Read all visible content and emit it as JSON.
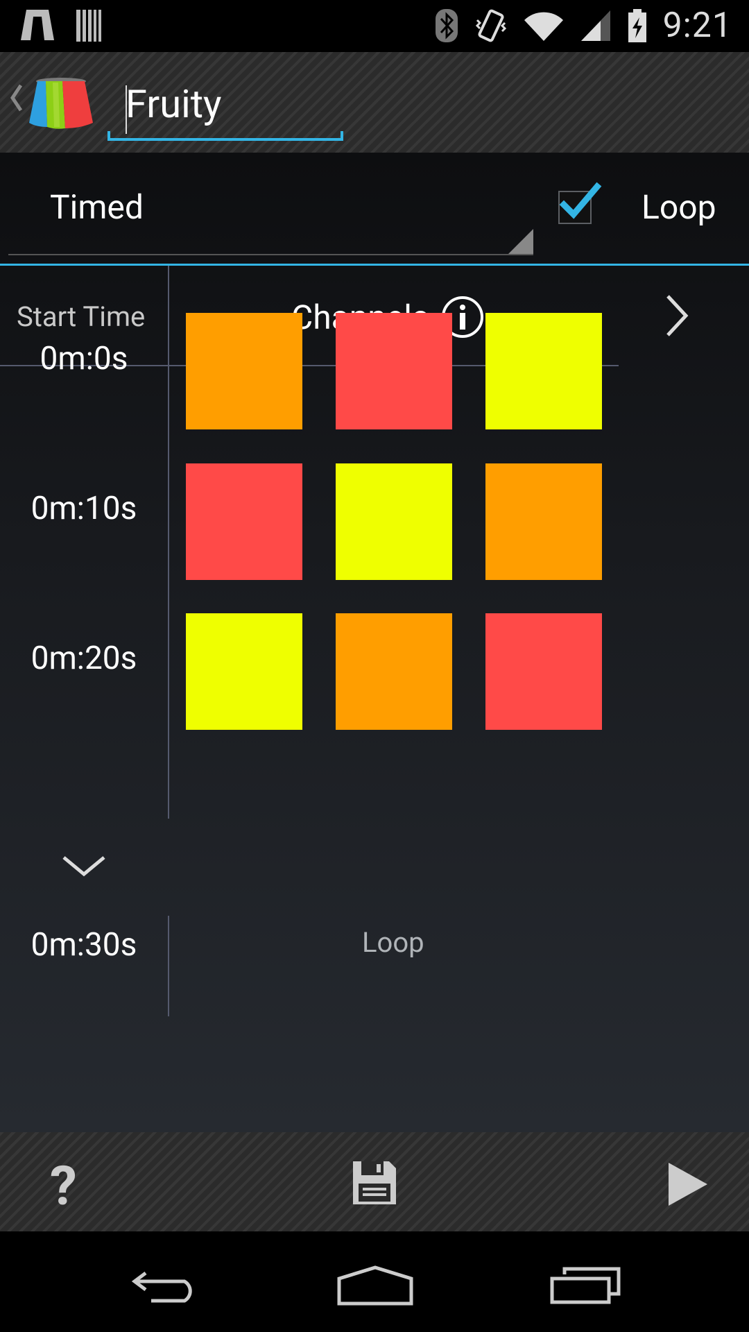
{
  "status_bar": {
    "time": "9:21",
    "icons": [
      "app-notification-icon",
      "barcode-notification-icon",
      "bluetooth-icon",
      "vibrate-icon",
      "wifi-icon",
      "signal-icon",
      "battery-charging-icon"
    ]
  },
  "action_bar": {
    "title": "Fruity",
    "icons": [
      "back-chevron-icon",
      "app-logo-icon"
    ]
  },
  "mode": {
    "selected": "Timed",
    "loop_checked": true,
    "loop_label": "Loop"
  },
  "grid": {
    "start_time_header": "Start Time",
    "channels_header": "Channels",
    "rows": [
      {
        "time": "0m:0s",
        "colors": [
          "#ff9e00",
          "#ff4a48",
          "#efff00"
        ]
      },
      {
        "time": "0m:10s",
        "colors": [
          "#ff4a48",
          "#efff00",
          "#ff9e00"
        ]
      },
      {
        "time": "0m:20s",
        "colors": [
          "#efff00",
          "#ff9e00",
          "#ff4a48"
        ]
      }
    ],
    "loop_row": {
      "time": "0m:30s",
      "label": "Loop"
    }
  },
  "bottom_bar": {
    "help_label": "?",
    "icons": [
      "help-icon",
      "save-icon",
      "play-icon"
    ]
  },
  "nav_bar": {
    "icons": [
      "back-icon",
      "home-icon",
      "recent-apps-icon"
    ]
  },
  "colors": {
    "accent": "#33b5e5",
    "orange": "#ff9e00",
    "red": "#ff4a48",
    "yellow": "#efff00"
  }
}
